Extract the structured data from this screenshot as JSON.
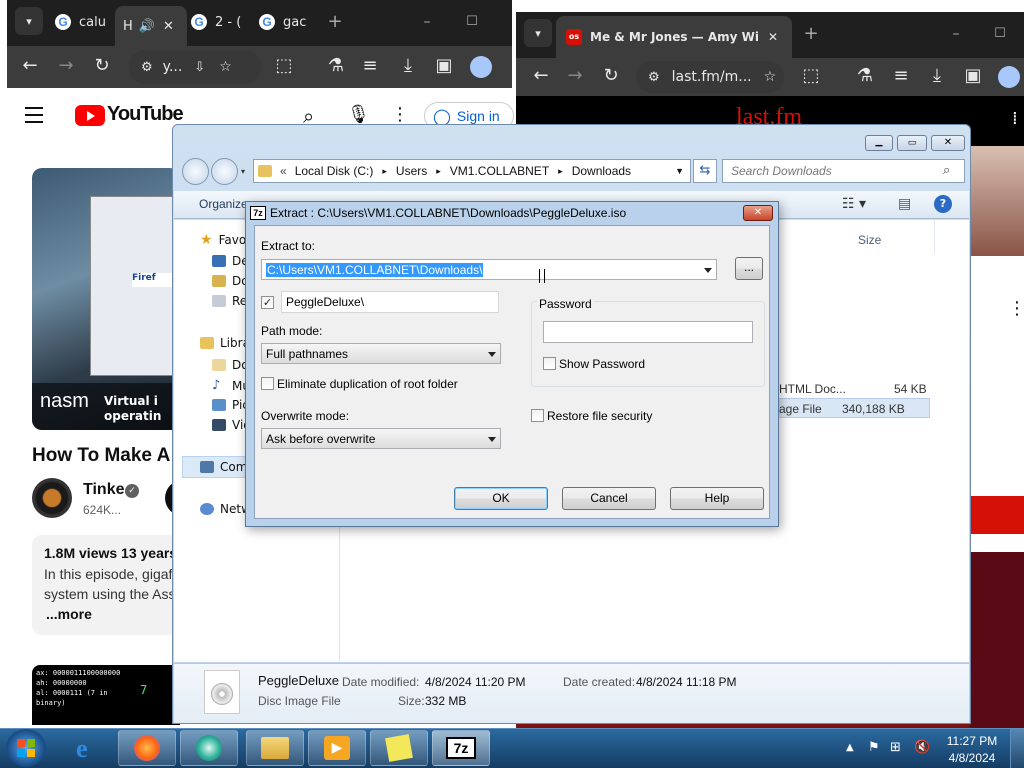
{
  "browser_left": {
    "tabs": [
      {
        "label": "calu"
      },
      {
        "label": "H"
      },
      {
        "label": "2 - ("
      },
      {
        "label": "gac"
      }
    ],
    "url": "y...",
    "youtube": {
      "logo_text": "YouTube",
      "sign_in": "Sign in",
      "video_title": "How To Make A",
      "channel": "Tinke",
      "subs": "624K...",
      "views": "1.8M views  13 years",
      "desc1": "In this episode, gigaf",
      "desc2": "system using the Ass",
      "more": "...more",
      "thumb_text": "nasm",
      "thumb_caption1": "Virtual i",
      "thumb_caption2": "operatin",
      "term_line1": "ax: 0000011100000000",
      "term_line2": "ah: 00000000",
      "term_line3": "al: 0000111 (7 in",
      "term_line4": "binary)",
      "term_num": "7"
    }
  },
  "browser_right": {
    "tab_label": "Me & Mr Jones — Amy Winehouse",
    "url": "last.fm/m...",
    "page_logo": "last.fm"
  },
  "explorer": {
    "breadcrumb": [
      "Local Disk (C:)",
      "Users",
      "VM1.COLLABNET",
      "Downloads"
    ],
    "search_placeholder": "Search Downloads",
    "organize": "Organize",
    "tree": [
      "Favo",
      "De",
      "Do",
      "Re",
      "Libra",
      "Do",
      "Mu",
      "Pic",
      "Vid",
      "Com",
      "Netw"
    ],
    "col_size": "Size",
    "files": [
      {
        "type": "HTML Doc...",
        "size": "54 KB"
      },
      {
        "type": "age File",
        "size": "340,188 KB"
      }
    ],
    "details": {
      "name": "PeggleDeluxe",
      "kind": "Disc Image File",
      "modified_label": "Date modified:",
      "modified": "4/8/2024 11:20 PM",
      "size_label": "Size:",
      "size": "332 MB",
      "created_label": "Date created:",
      "created": "4/8/2024 11:18 PM"
    }
  },
  "dialog": {
    "title": "Extract : C:\\Users\\VM1.COLLABNET\\Downloads\\PeggleDeluxe.iso",
    "extract_to_label": "Extract to:",
    "extract_to_value": "C:\\Users\\VM1.COLLABNET\\Downloads\\",
    "browse": "...",
    "subfolder_checked": true,
    "subfolder": "PeggleDeluxe\\",
    "path_mode_label": "Path mode:",
    "path_mode": "Full pathnames",
    "eliminate_dup": "Eliminate duplication of root folder",
    "overwrite_label": "Overwrite mode:",
    "overwrite": "Ask before overwrite",
    "password_label": "Password",
    "show_password": "Show Password",
    "restore_security": "Restore file security",
    "ok": "OK",
    "cancel": "Cancel",
    "help": "Help"
  },
  "taskbar": {
    "time": "11:27 PM",
    "date": "4/8/2024",
    "sevenzip": "7z"
  },
  "colors": {
    "selection": "#3399ff",
    "youtube_red": "#ff0000",
    "lastfm_red": "#d51007",
    "taskbar": "#1c4d7a"
  }
}
